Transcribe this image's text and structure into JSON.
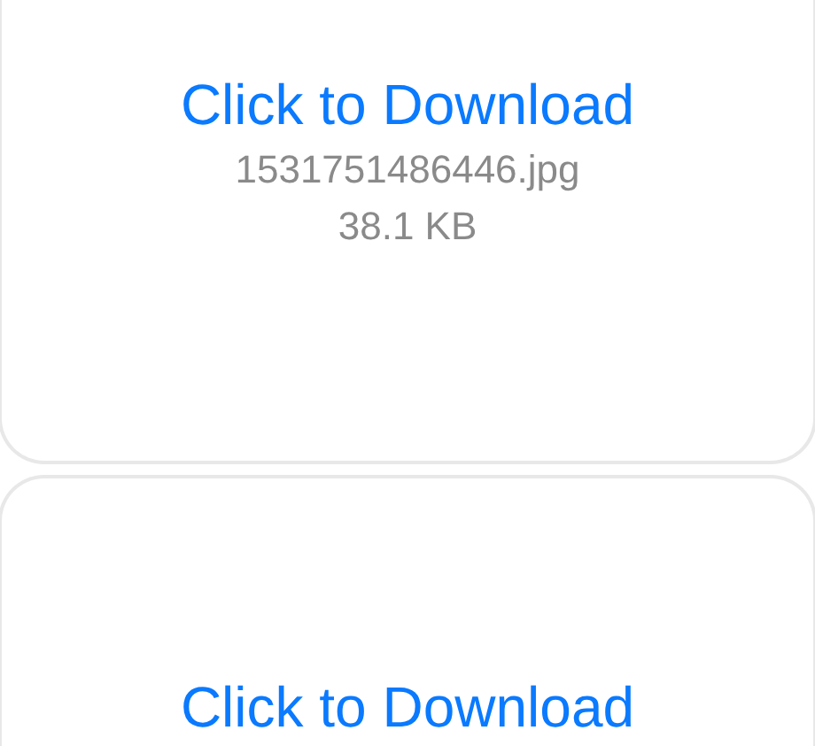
{
  "attachments": [
    {
      "link": "Click to Download",
      "filename": "1531751486446.jpg",
      "size": "38.1 KB"
    },
    {
      "link": "Click to Download"
    }
  ]
}
